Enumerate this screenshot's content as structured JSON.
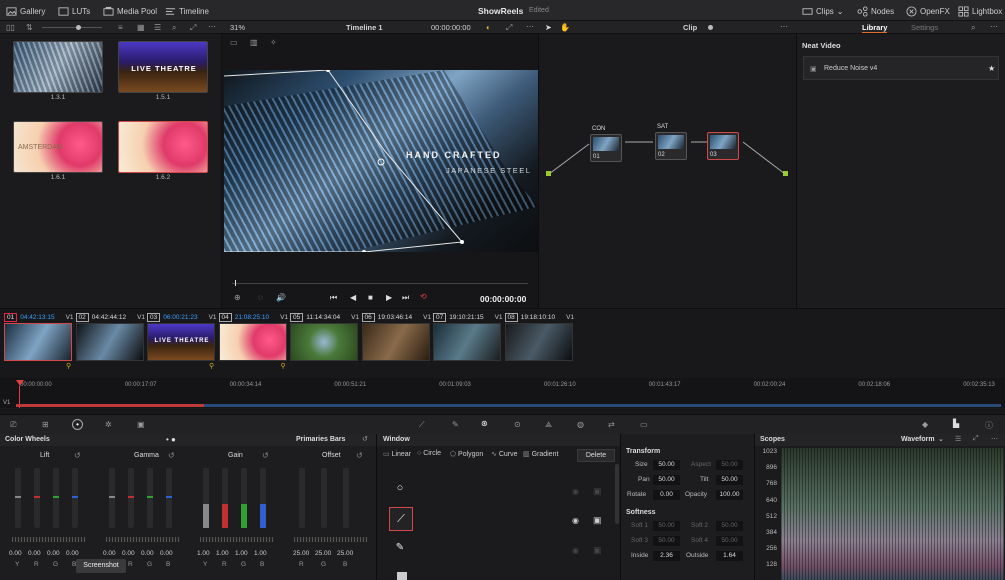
{
  "topbar": {
    "gallery": "Gallery",
    "luts": "LUTs",
    "media_pool": "Media Pool",
    "timeline": "Timeline",
    "project_title": "ShowReels",
    "project_status": "Edited",
    "clips": "Clips",
    "nodes": "Nodes",
    "openfx": "OpenFX",
    "lightbox": "Lightbox"
  },
  "viewer_bar": {
    "zoom": "31%",
    "timeline_name": "Timeline 1",
    "timecode": "00:00:00:00",
    "clip_menu": "Clip"
  },
  "library": {
    "tab_library": "Library",
    "tab_settings": "Settings",
    "section_title": "Neat Video",
    "item": "Reduce Noise v4"
  },
  "gallery": {
    "stills": [
      {
        "label": "1.3.1",
        "text": ""
      },
      {
        "label": "1.5.1",
        "text": "LIVE THEATRE"
      },
      {
        "label": "1.6.1",
        "text": "AMSTERDAM"
      },
      {
        "label": "1.6.2",
        "text": ""
      }
    ]
  },
  "viewer": {
    "overlay_title": "HAND CRAFTED",
    "overlay_subtitle": "JAPANESE STEEL",
    "playback_timecode": "00:00:00:00"
  },
  "nodes": [
    {
      "label": "CON",
      "number": "01"
    },
    {
      "label": "SAT",
      "number": "02"
    },
    {
      "label": "",
      "number": "03"
    }
  ],
  "timeline": {
    "clips": [
      {
        "num": "01",
        "tc": "04:42:13:15",
        "track": "V1",
        "blue": true
      },
      {
        "num": "02",
        "tc": "04:42:44:12",
        "track": "V1",
        "blue": false
      },
      {
        "num": "03",
        "tc": "06:00:21:23",
        "track": "V1",
        "blue": true
      },
      {
        "num": "04",
        "tc": "21:08:25:10",
        "track": "V1",
        "blue": true
      },
      {
        "num": "05",
        "tc": "11:14:34:04",
        "track": "V1",
        "blue": false
      },
      {
        "num": "06",
        "tc": "19:03:46:14",
        "track": "V1",
        "blue": false
      },
      {
        "num": "07",
        "tc": "19:10:21:15",
        "track": "V1",
        "blue": false
      },
      {
        "num": "08",
        "tc": "19:18:10:10",
        "track": "V1",
        "blue": false
      }
    ],
    "clip_text_live": "LIVE THEATRE",
    "ruler": [
      "00:00:00:00",
      "00:00:17:07",
      "00:00:34:14",
      "00:00:51:21",
      "00:01:09:03",
      "00:01:26:10",
      "00:01:43:17",
      "00:02:00:24",
      "00:02:18:06",
      "00:02:35:13"
    ],
    "track_label": "V1"
  },
  "colorwheels": {
    "title": "Color Wheels",
    "mode": "Primaries Bars",
    "wheels": [
      {
        "name": "Lift",
        "values": [
          "0.00",
          "0.00",
          "0.00",
          "0.00"
        ]
      },
      {
        "name": "Gamma",
        "values": [
          "0.00",
          "0.00",
          "0.00",
          "0.00"
        ]
      },
      {
        "name": "Gain",
        "values": [
          "1.00",
          "1.00",
          "1.00",
          "1.00"
        ]
      },
      {
        "name": "Offset",
        "values": [
          "25.00",
          "25.00",
          "25.00"
        ]
      }
    ],
    "channels4": [
      "Y",
      "R",
      "G",
      "B"
    ],
    "channels3": [
      "R",
      "G",
      "B"
    ],
    "tooltip": "Screenshot"
  },
  "window": {
    "title": "Window",
    "tools": [
      "Linear",
      "Circle",
      "Polygon",
      "Curve",
      "Gradient"
    ],
    "delete": "Delete"
  },
  "transform": {
    "title": "Transform",
    "size_label": "Size",
    "size": "50.00",
    "aspect_label": "Aspect",
    "aspect": "50.00",
    "pan_label": "Pan",
    "pan": "50.00",
    "tilt_label": "Tilt",
    "tilt": "50.00",
    "rotate_label": "Rotate",
    "rotate": "0.00",
    "opacity_label": "Opacity",
    "opacity": "100.00",
    "softness_title": "Softness",
    "soft1_label": "Soft 1",
    "soft1": "50.00",
    "soft2_label": "Soft 2",
    "soft2": "50.00",
    "soft3_label": "Soft 3",
    "soft3": "50.00",
    "soft4_label": "Soft 4",
    "soft4": "50.00",
    "inside_label": "Inside",
    "inside": "2.36",
    "outside_label": "Outside",
    "outside": "1.64"
  },
  "scopes": {
    "title": "Scopes",
    "mode": "Waveform",
    "scale": [
      "1023",
      "896",
      "768",
      "640",
      "512",
      "384",
      "256",
      "128"
    ]
  }
}
